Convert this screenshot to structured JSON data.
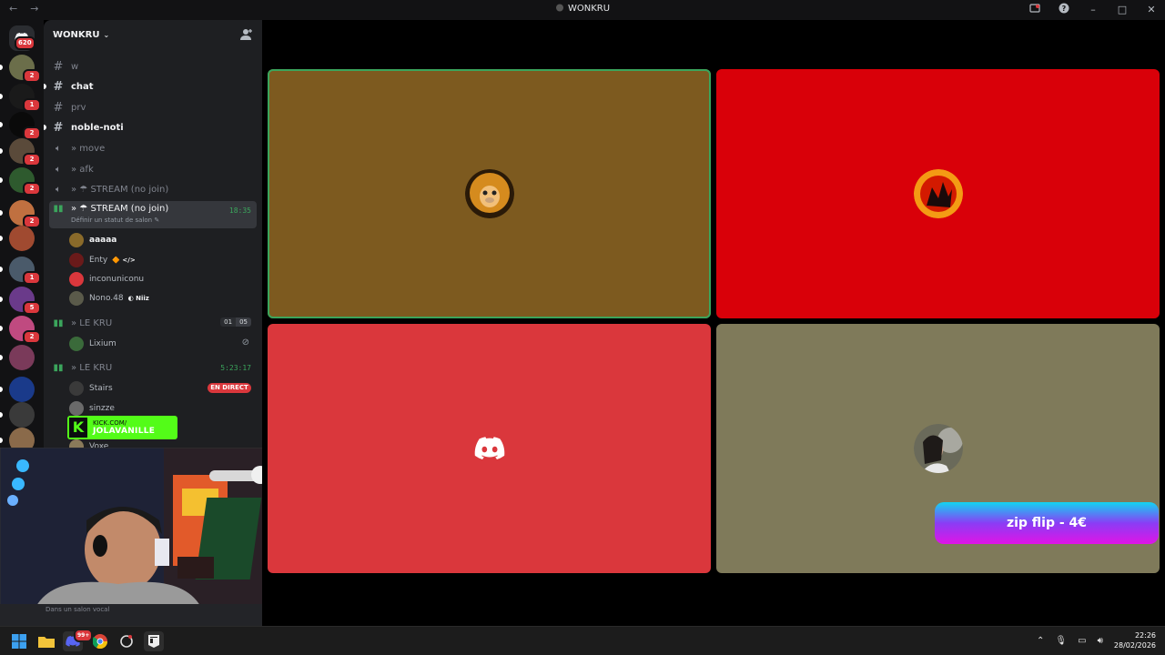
{
  "window": {
    "title": "WONKRU",
    "back": "←",
    "forward": "→"
  },
  "rail": {
    "home_badge": "620",
    "servers": [
      {
        "name": "server-1",
        "color": "#6b6e4a",
        "badge": "2"
      },
      {
        "name": "server-2",
        "color": "#1a1a1a",
        "badge": "1"
      },
      {
        "name": "server-3",
        "color": "#0a0a0a",
        "badge": "2"
      },
      {
        "name": "server-4",
        "color": "#5a4a3a",
        "badge": "2"
      },
      {
        "name": "server-5",
        "color": "#2e5a2e",
        "badge": "2"
      },
      {
        "name": "server-6",
        "color": "#c07040",
        "badge": "2"
      },
      {
        "name": "server-7",
        "color": "#a04a30",
        "badge": ""
      },
      {
        "name": "server-8",
        "color": "#4a5a6a",
        "badge": "1"
      },
      {
        "name": "server-9",
        "color": "#6a3a8a",
        "badge": "5"
      },
      {
        "name": "server-10",
        "color": "#c04a80",
        "badge": "2"
      },
      {
        "name": "server-11",
        "color": "#7a3a5a",
        "badge": ""
      },
      {
        "name": "server-12",
        "color": "#1a3a8a",
        "badge": ""
      },
      {
        "name": "server-13",
        "color": "#3a3a3a",
        "badge": ""
      },
      {
        "name": "server-14",
        "color": "#8a6a4a",
        "badge": ""
      }
    ]
  },
  "guild": {
    "name": "WONKRU",
    "chevron": "⌄"
  },
  "channels": {
    "text": [
      {
        "label": "w",
        "unread": false
      },
      {
        "label": "chat",
        "unread": true
      },
      {
        "label": "prv",
        "unread": false
      },
      {
        "label": "noble-noti",
        "unread": true
      }
    ],
    "voice_move": "» move",
    "voice_afk": "» afk",
    "stream1": "» ☂ STREAM (no join)",
    "stream2": {
      "label": "» ☂ STREAM (no join)",
      "time": "18:35",
      "status": "Définir un statut de salon ✎"
    },
    "stream2_users": [
      {
        "name": "aaaaa",
        "tag": "",
        "avatar": "#8a6a2a",
        "bold": true
      },
      {
        "name": "Enty",
        "tag": "🔶 </>",
        "avatar": "#6a1a1a",
        "bold": false
      },
      {
        "name": "inconuniconu",
        "tag": "",
        "avatar": "#da373c",
        "bold": false
      },
      {
        "name": "Nono.48",
        "tag": "◐ Niiz",
        "avatar": "#5a5a4a",
        "bold": false
      }
    ],
    "kru1": {
      "label": "» LE KRU",
      "count_a": "01",
      "count_b": "05"
    },
    "kru1_users": [
      {
        "name": "Lixium",
        "avatar": "#3a6a3a"
      }
    ],
    "kru2": {
      "label": "» LE KRU",
      "time": "5:23:17"
    },
    "kru2_users": [
      {
        "name": "Stairs",
        "avatar": "#3a3a3a",
        "live": "EN DIRECT"
      },
      {
        "name": "sinzze",
        "avatar": "#6a6a6a",
        "live": ""
      },
      {
        "name": "Voxe",
        "avatar": "#8a7a5a",
        "live": ""
      }
    ]
  },
  "overlay": {
    "kick_line1": "KICK.COM/",
    "kick_line2": "JOLAVANILLE"
  },
  "status_text": "Dans un salon vocal",
  "tiles": [
    {
      "name": "tile-aaaaa",
      "bg": "#7d5a1f",
      "avatar": "monkey",
      "speaking": true
    },
    {
      "name": "tile-enty",
      "bg": "#d90009",
      "avatar": "flame",
      "speaking": false
    },
    {
      "name": "tile-inconuniconu",
      "bg": "#da373c",
      "avatar": "discord",
      "speaking": false
    },
    {
      "name": "tile-nono",
      "bg": "#7f7a5a",
      "avatar": "photo",
      "speaking": false
    }
  ],
  "promo": "zip flip - 4€",
  "taskbar": {
    "time": "22:26",
    "date": "28/02/2026",
    "discord_badge": "99+"
  }
}
